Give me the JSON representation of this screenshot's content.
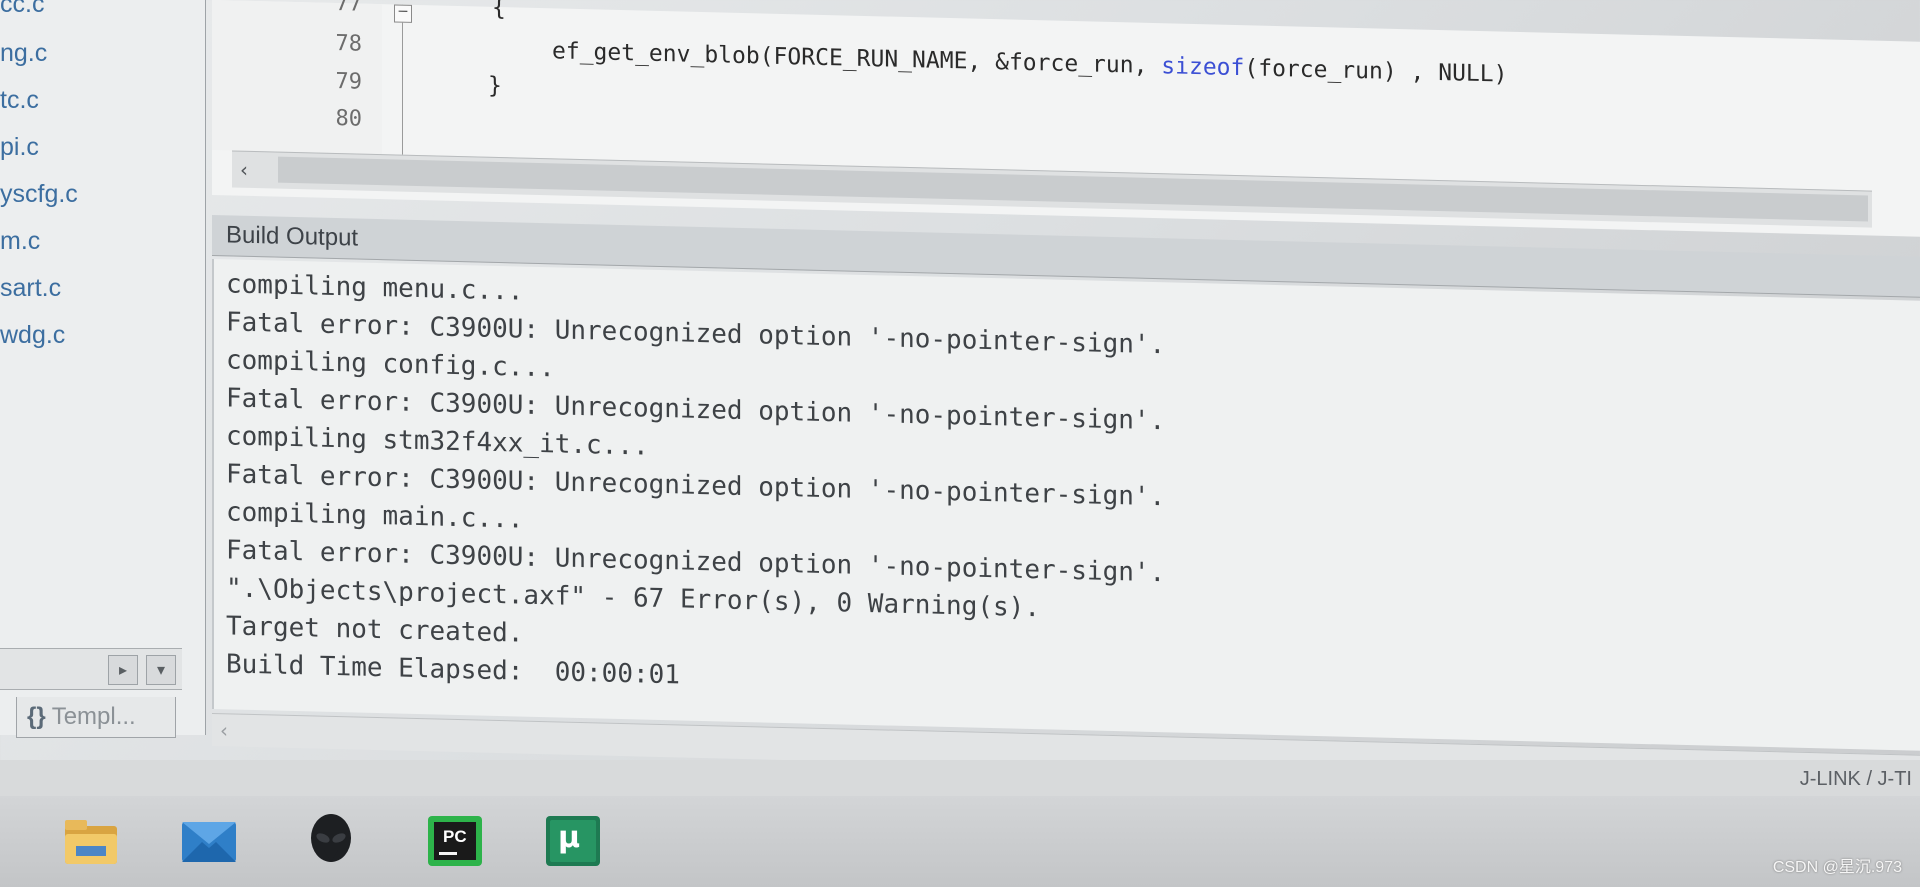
{
  "project_panel": {
    "files": [
      "cc.c",
      "ng.c",
      "tc.c",
      "pi.c",
      "yscfg.c",
      "m.c",
      "sart.c",
      "wdg.c"
    ],
    "tab_label": "Templ..."
  },
  "editor": {
    "line_numbers": [
      "77",
      "78",
      "79",
      "80"
    ],
    "lines": [
      {
        "text": "{"
      },
      {
        "prefix": "ef_get_env_blob(FORCE_RUN_NAME, &force_run, ",
        "keyword": "sizeof",
        "suffix": "(force_run) , NULL)"
      },
      {
        "text": "}"
      },
      {
        "text": ""
      }
    ]
  },
  "build_output": {
    "title": "Build Output",
    "lines": [
      "compiling menu.c...",
      "Fatal error: C3900U: Unrecognized option '-no-pointer-sign'.",
      "compiling config.c...",
      "Fatal error: C3900U: Unrecognized option '-no-pointer-sign'.",
      "compiling stm32f4xx_it.c...",
      "Fatal error: C3900U: Unrecognized option '-no-pointer-sign'.",
      "compiling main.c...",
      "Fatal error: C3900U: Unrecognized option '-no-pointer-sign'.",
      "\".\\Objects\\project.axf\" - 67 Error(s), 0 Warning(s).",
      "Target not created.",
      "Build Time Elapsed:  00:00:01"
    ]
  },
  "status_bar": {
    "debugger": "J-LINK / J-TI"
  },
  "taskbar": {
    "icons": [
      "file-explorer-icon",
      "mail-icon",
      "alienware-icon",
      "pycharm-icon",
      "keil-uvision-icon"
    ],
    "pycharm_label": "PC",
    "keil_label": "μ"
  },
  "watermark": "CSDN @星沉.973",
  "colors": {
    "keyword": "#3b4fd4",
    "file_name": "#3c6ea0",
    "output_text": "#3e4246"
  }
}
